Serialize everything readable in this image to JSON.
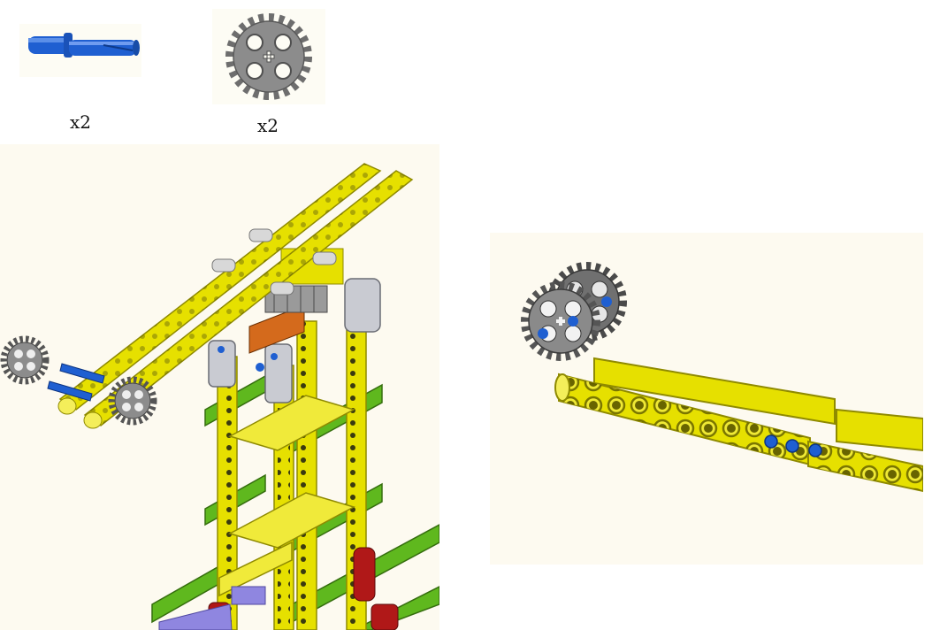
{
  "parts": [
    {
      "icon": "blue-axle-pin-icon",
      "qty": "x2"
    },
    {
      "icon": "gray-gear-24-tooth-icon",
      "qty": "x2"
    }
  ],
  "colors": {
    "yellow": "#e6e000",
    "yellow_dark": "#a9a400",
    "green": "#5fb81e",
    "gray": "#8a8a8a",
    "light_gray": "#c9cbd2",
    "blue": "#1f5fd1",
    "red": "#b01818",
    "lavender": "#8f86e0",
    "orange": "#d46a1c",
    "panel_bg": "#fdfaf0"
  }
}
